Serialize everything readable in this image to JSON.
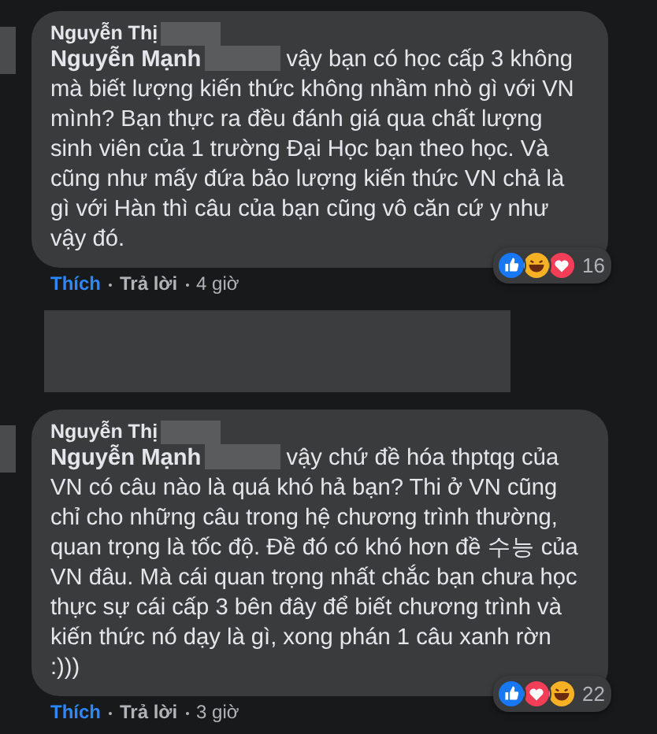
{
  "comments": [
    {
      "author": "Nguyễn Thị",
      "mention": "Nguyễn Mạnh",
      "body": "vậy bạn có học cấp 3 không mà biết lượng kiến thức không nhầm nhò gì với VN mình? Bạn thực ra đều đánh giá qua chất lượng sinh viên của 1 trường Đại Học bạn theo học. Và cũng như mấy đứa bảo lượng kiến thức VN chả là gì với Hàn thì câu của bạn cũng vô căn cứ y như vậy đó.",
      "reactions": [
        {
          "kind": "like"
        },
        {
          "kind": "haha"
        },
        {
          "kind": "love"
        }
      ],
      "reaction_count": "16",
      "liked": true,
      "like_label": "Thích",
      "reply_label": "Trả lời",
      "time": "4 giờ"
    },
    {
      "author": "Nguyễn Thị",
      "mention": "Nguyễn Mạnh",
      "body": "vậy chứ đề hóa thptqg của VN có câu nào là quá khó hả bạn? Thi ở VN cũng chỉ cho những câu trong hệ chương trình thường, quan trọng là tốc độ. Đề đó có khó hơn đề 수능 của VN đâu. Mà cái quan trọng nhất chắc bạn chưa học thực sự cái cấp 3 bên đây để biết chương trình và kiến thức nó dạy là gì, xong phán 1 câu xanh rờn :)))",
      "reactions": [
        {
          "kind": "like"
        },
        {
          "kind": "love"
        },
        {
          "kind": "haha"
        }
      ],
      "reaction_count": "22",
      "liked": true,
      "like_label": "Thích",
      "reply_label": "Trả lời",
      "time": "3 giờ"
    }
  ]
}
